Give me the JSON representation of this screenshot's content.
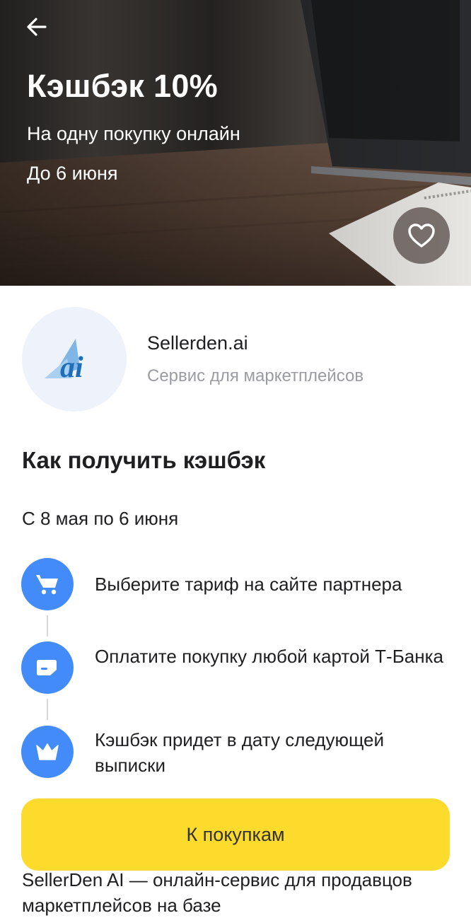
{
  "hero": {
    "title": "Кэшбэк 10%",
    "subtitle": "На одну покупку онлайн",
    "deadline": "До 6 июня",
    "back_icon": "arrow-left-icon",
    "favorite_icon": "heart-outline-icon"
  },
  "partner": {
    "name": "Sellerden.ai",
    "description": "Сервис для маркетплейсов",
    "logo_text": "ai"
  },
  "how_to": {
    "title": "Как получить кэшбэк",
    "period": "С 8 мая по 6 июня",
    "steps": [
      {
        "icon": "cart-icon",
        "text": "Выберите тариф на сайте партнера"
      },
      {
        "icon": "card-icon",
        "text": "Оплатите покупку любой картой Т-Банка"
      },
      {
        "icon": "crown-icon",
        "text": "Кэшбэк придет в дату следующей выписки"
      }
    ]
  },
  "cta": {
    "label": "К покупкам"
  },
  "about": {
    "text": "SellerDen AI — онлайн-сервис для продавцов маркетплейсов на базе"
  },
  "colors": {
    "accent_yellow": "#fddb2d",
    "step_blue": "#428bf9",
    "muted_text": "#9a9ca1"
  }
}
